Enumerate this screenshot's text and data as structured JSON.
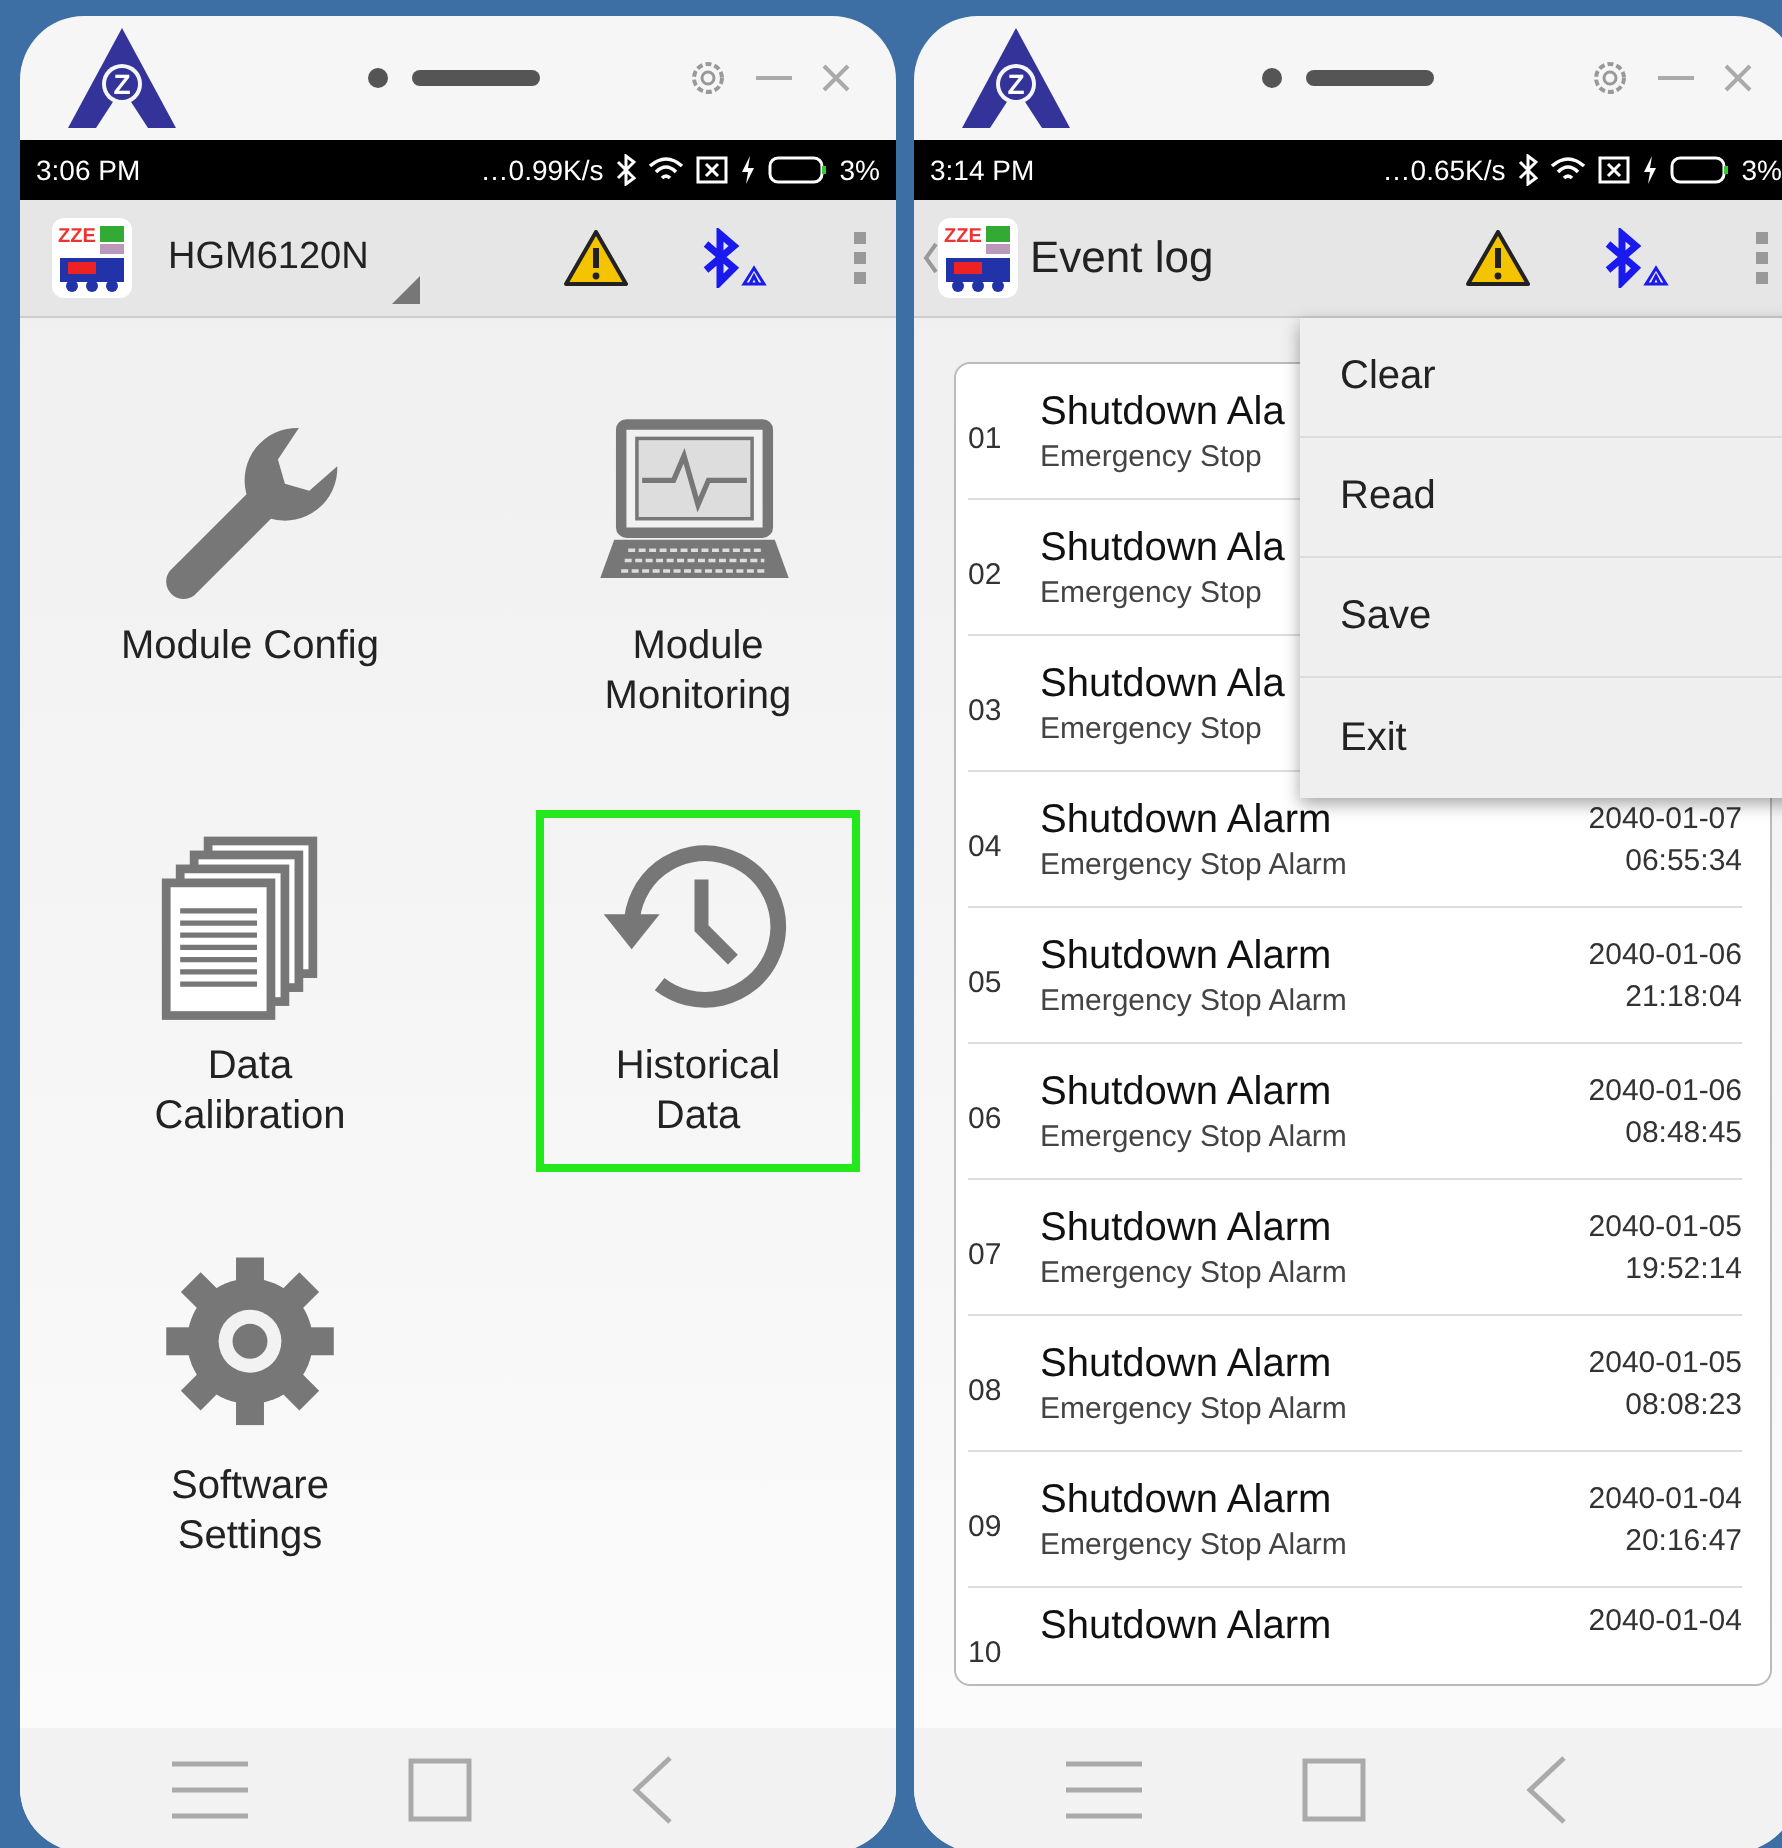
{
  "phones": [
    {
      "logo_letter": "Z",
      "status_bar": {
        "time": "3:06 PM",
        "speed": "…0.99K/s",
        "battery": "3%"
      },
      "app_bar": {
        "back": false,
        "app_icon_text": "ZZE",
        "title": "HGM6120N",
        "dropdown": true
      },
      "content": {
        "kind": "tiles",
        "tiles": [
          {
            "lines": [
              "Module Config"
            ],
            "kind": "wrench",
            "selected": false
          },
          {
            "lines": [
              "Module",
              "Monitoring"
            ],
            "kind": "monitor",
            "selected": false
          },
          {
            "lines": [
              "Data",
              "Calibration"
            ],
            "kind": "documents",
            "selected": false
          },
          {
            "lines": [
              "Historical",
              "Data"
            ],
            "kind": "history",
            "selected": true
          },
          {
            "lines": [
              "Software",
              "Settings"
            ],
            "kind": "gear",
            "selected": false
          }
        ]
      }
    },
    {
      "logo_letter": "Z",
      "status_bar": {
        "time": "3:14 PM",
        "speed": "…0.65K/s",
        "battery": "3%"
      },
      "app_bar": {
        "back": true,
        "app_icon_text": "ZZE",
        "title": "Event log",
        "dropdown": false
      },
      "content": {
        "kind": "event_log",
        "events": [
          {
            "number": "01",
            "title": "Shutdown Ala",
            "subtitle": "Emergency Stop"
          },
          {
            "number": "02",
            "title": "Shutdown Ala",
            "subtitle": "Emergency Stop"
          },
          {
            "number": "03",
            "title": "Shutdown Ala",
            "subtitle": "Emergency Stop"
          },
          {
            "number": "04",
            "title": "Shutdown Alarm",
            "subtitle": "Emergency Stop Alarm",
            "date": "2040-01-07",
            "time": "06:55:34"
          },
          {
            "number": "05",
            "title": "Shutdown Alarm",
            "subtitle": "Emergency Stop Alarm",
            "date": "2040-01-06",
            "time": "21:18:04"
          },
          {
            "number": "06",
            "title": "Shutdown Alarm",
            "subtitle": "Emergency Stop Alarm",
            "date": "2040-01-06",
            "time": "08:48:45"
          },
          {
            "number": "07",
            "title": "Shutdown Alarm",
            "subtitle": "Emergency Stop Alarm",
            "date": "2040-01-05",
            "time": "19:52:14"
          },
          {
            "number": "08",
            "title": "Shutdown Alarm",
            "subtitle": "Emergency Stop Alarm",
            "date": "2040-01-05",
            "time": "08:08:23"
          },
          {
            "number": "09",
            "title": "Shutdown Alarm",
            "subtitle": "Emergency Stop Alarm",
            "date": "2040-01-04",
            "time": "20:16:47"
          },
          {
            "number": "10",
            "title": "Shutdown Alarm",
            "date": "2040-01-04"
          }
        ],
        "menu": {
          "items": [
            "Clear",
            "Read",
            "Save",
            "Exit"
          ]
        }
      }
    }
  ]
}
